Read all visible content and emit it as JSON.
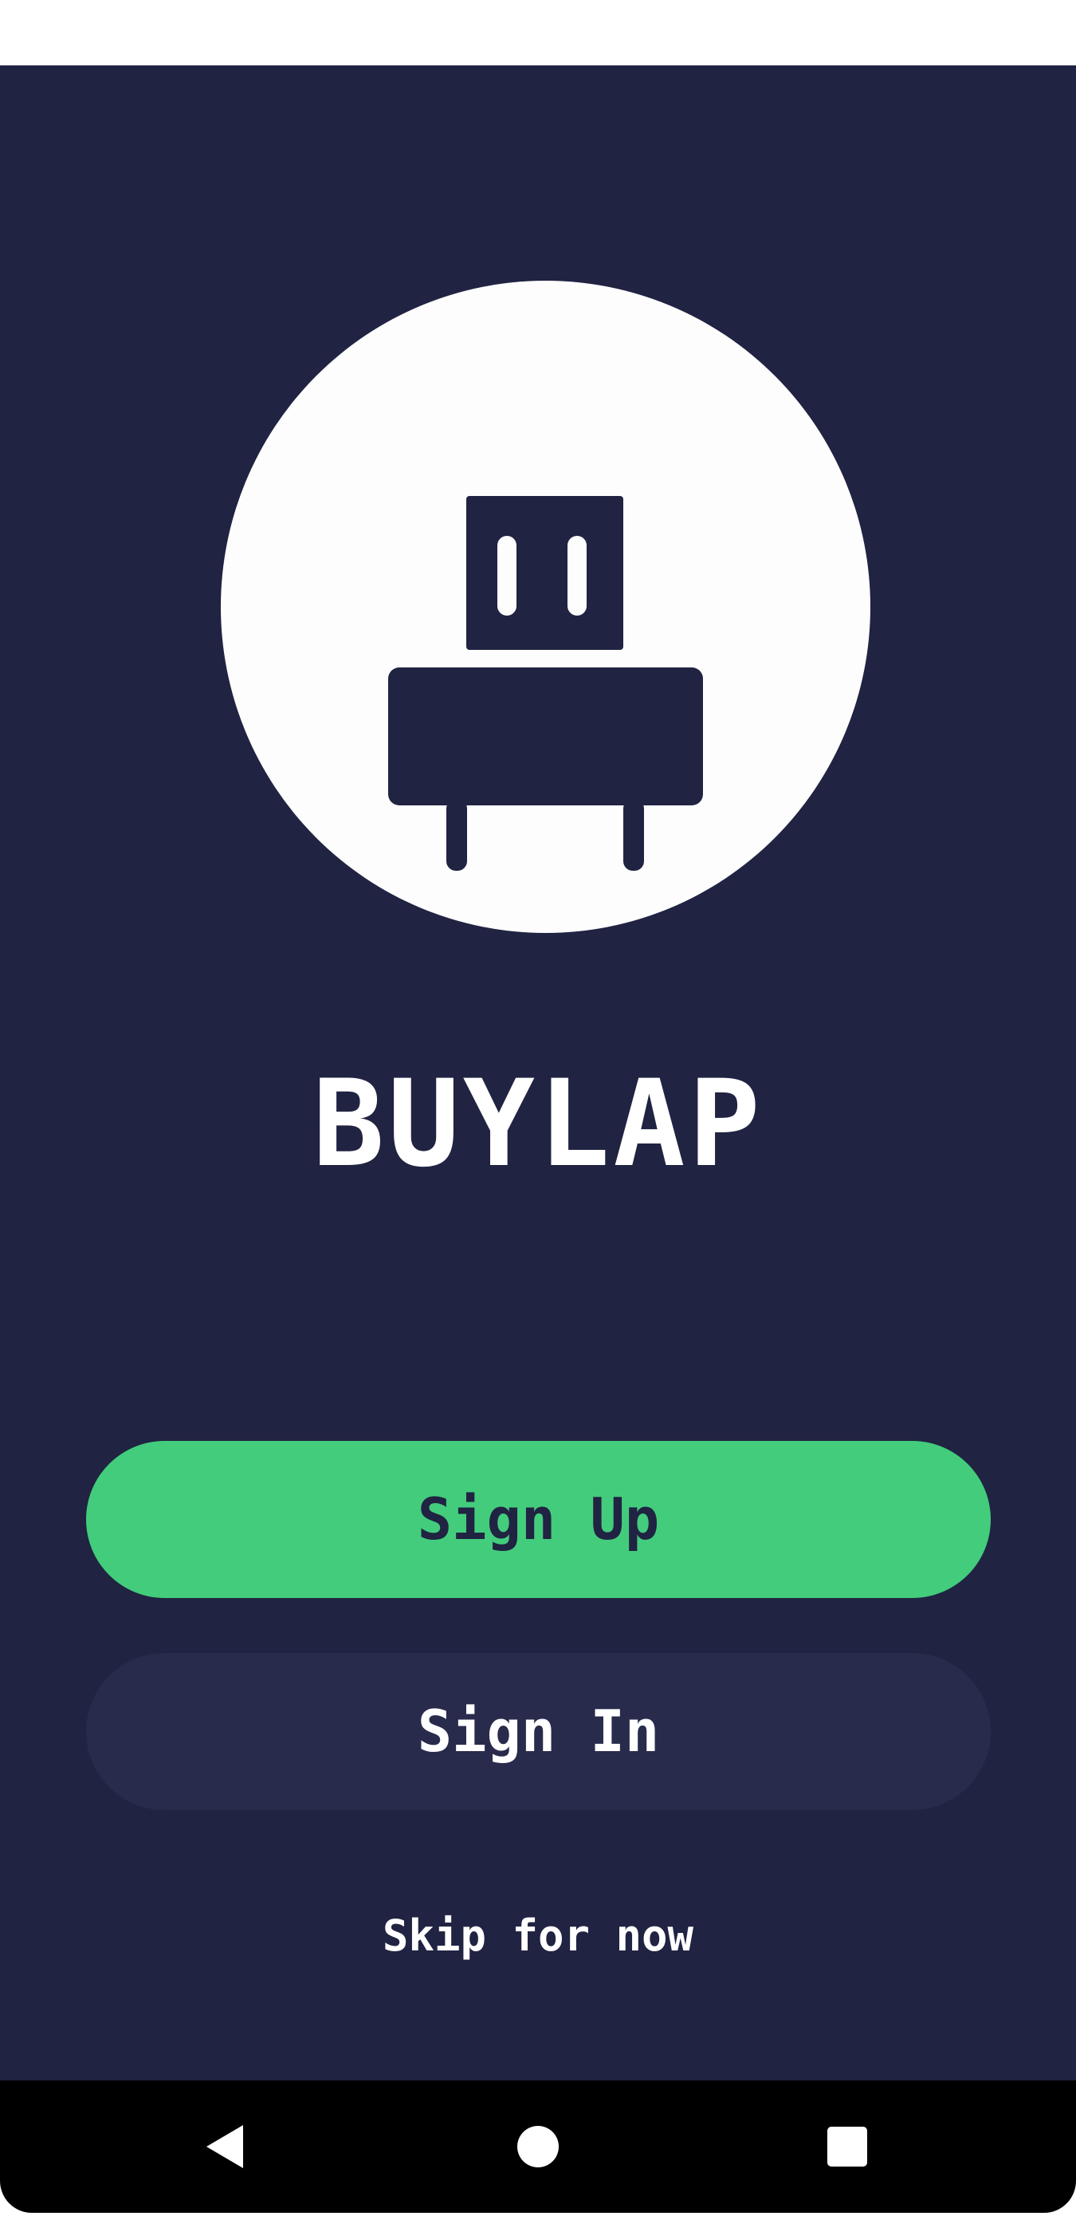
{
  "app": {
    "title": "BUYLAP"
  },
  "logo": {
    "icon": "power-plug-icon"
  },
  "actions": {
    "sign_up_label": "Sign Up",
    "sign_in_label": "Sign In",
    "skip_label": "Skip for now"
  },
  "navigation": {
    "back_icon": "back-triangle-icon",
    "home_icon": "home-circle-icon",
    "recents_icon": "recents-square-icon"
  },
  "colors": {
    "background": "#202342",
    "primary_button": "#43cc7c",
    "secondary_button": "#282b4b",
    "text_light": "#ffffff",
    "nav_bar": "#000000"
  }
}
